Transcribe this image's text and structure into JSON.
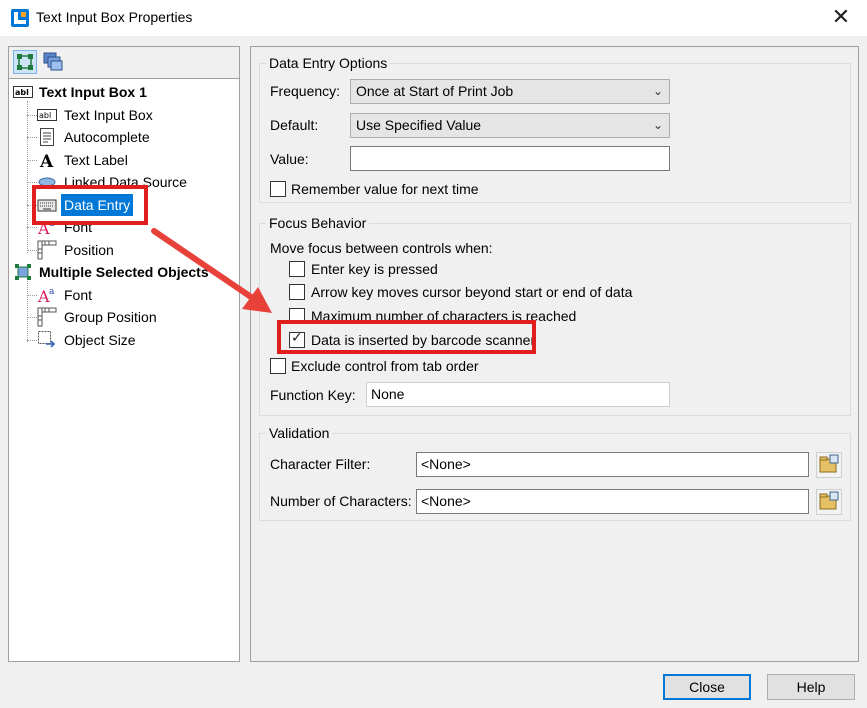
{
  "window": {
    "title": "Text Input Box Properties",
    "close_glyph": "✕"
  },
  "left_panel": {
    "toolbar_icons": [
      "component-view-icon",
      "layers-icon"
    ],
    "tree": [
      {
        "label": "Text Input Box 1",
        "icon": "text-input-box-icon",
        "bold": true
      },
      {
        "label": "Text Input Box",
        "icon": "text-input-box-icon"
      },
      {
        "label": "Autocomplete",
        "icon": "autocomplete-icon"
      },
      {
        "label": "Text Label",
        "icon": "text-label-icon"
      },
      {
        "label": "Linked Data Source",
        "icon": "linked-data-source-icon"
      },
      {
        "label": "Data Entry",
        "icon": "keyboard-icon",
        "selected": true
      },
      {
        "label": "Font",
        "icon": "font-icon"
      },
      {
        "label": "Position",
        "icon": "position-icon"
      },
      {
        "label": "Multiple Selected Objects",
        "icon": "multiple-objects-icon",
        "bold": true
      },
      {
        "label": "Font",
        "icon": "font-icon"
      },
      {
        "label": "Group Position",
        "icon": "position-icon"
      },
      {
        "label": "Object Size",
        "icon": "object-size-icon"
      }
    ]
  },
  "data_entry_options": {
    "title": "Data Entry Options",
    "frequency_label": "Frequency:",
    "frequency_value": "Once at Start of Print Job",
    "default_label": "Default:",
    "default_value": "Use Specified Value",
    "value_label": "Value:",
    "value_value": "",
    "remember_label": "Remember value for next time",
    "remember_checked": false
  },
  "focus_behavior": {
    "title": "Focus Behavior",
    "move_focus_label": "Move focus between controls when:",
    "options": [
      {
        "label": "Enter key is pressed",
        "checked": false
      },
      {
        "label": "Arrow key moves cursor beyond start or end of data",
        "checked": false
      },
      {
        "label": "Maximum number of characters is reached",
        "checked": false
      },
      {
        "label": "Data is inserted by barcode scanner",
        "checked": true
      }
    ],
    "exclude_label": "Exclude control from tab order",
    "exclude_checked": false,
    "function_key_label": "Function Key:",
    "function_key_value": "None"
  },
  "validation": {
    "title": "Validation",
    "character_filter_label": "Character Filter:",
    "character_filter_value": "<None>",
    "number_of_characters_label": "Number of Characters:",
    "number_of_characters_value": "<None>"
  },
  "buttons": {
    "close": "Close",
    "help": "Help"
  },
  "colors": {
    "selection": "#0078d7",
    "annotation_red": "#e01e1e"
  }
}
